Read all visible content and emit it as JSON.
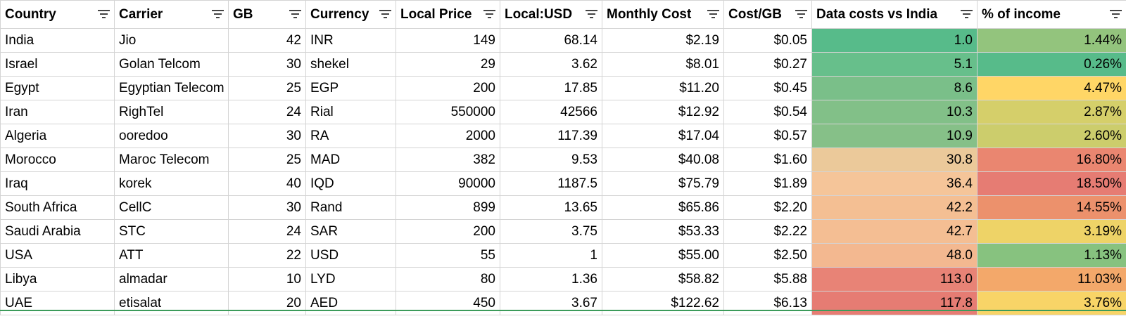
{
  "headers": [
    "Country",
    "Carrier",
    "GB",
    "Currency",
    "Local Price",
    "Local:USD",
    "Monthly Cost",
    "Cost/GB",
    "Data costs vs India",
    "% of income"
  ],
  "icons": {
    "filter": "filter-icon"
  },
  "colors": {
    "grid_line": "#d4d4d4",
    "frozen_bottom_line": "#3c9b5a"
  },
  "rows": [
    {
      "country": "India",
      "carrier": "Jio",
      "gb": "42",
      "currency": "INR",
      "local_price": "149",
      "local_usd": "68.14",
      "monthly_cost": "$2.19",
      "cost_gb": "$0.05",
      "vs_india": "1.0",
      "pct_income": "1.44%",
      "vs_color": "#57bb8a",
      "inc_color": "#93c47d"
    },
    {
      "country": "Israel",
      "carrier": "Golan Telcom",
      "gb": "30",
      "currency": "shekel",
      "local_price": "29",
      "local_usd": "3.62",
      "monthly_cost": "$8.01",
      "cost_gb": "$0.27",
      "vs_india": "5.1",
      "pct_income": "0.26%",
      "vs_color": "#67bf8b",
      "inc_color": "#57bb8a"
    },
    {
      "country": "Egypt",
      "carrier": "Egyptian Telecom",
      "gb": "25",
      "currency": "EGP",
      "local_price": "200",
      "local_usd": "17.85",
      "monthly_cost": "$11.20",
      "cost_gb": "$0.45",
      "vs_india": "8.6",
      "pct_income": "4.47%",
      "vs_color": "#7abf89",
      "inc_color": "#ffd666"
    },
    {
      "country": "Iran",
      "carrier": "RighTel",
      "gb": "24",
      "currency": "Rial",
      "local_price": "550000",
      "local_usd": "42566",
      "monthly_cost": "$12.92",
      "cost_gb": "$0.54",
      "vs_india": "10.3",
      "pct_income": "2.87%",
      "vs_color": "#82c088",
      "inc_color": "#d5cf6a"
    },
    {
      "country": "Algeria",
      "carrier": "ooredoo",
      "gb": "30",
      "currency": "RA",
      "local_price": "2000",
      "local_usd": "117.39",
      "monthly_cost": "$17.04",
      "cost_gb": "$0.57",
      "vs_india": "10.9",
      "pct_income": "2.60%",
      "vs_color": "#86c088",
      "inc_color": "#cccd6c"
    },
    {
      "country": "Morocco",
      "carrier": "Maroc Telecom",
      "gb": "25",
      "currency": "MAD",
      "local_price": "382",
      "local_usd": "9.53",
      "monthly_cost": "$40.08",
      "cost_gb": "$1.60",
      "vs_india": "30.8",
      "pct_income": "16.80%",
      "vs_color": "#ebc99a",
      "inc_color": "#ea8670"
    },
    {
      "country": "Iraq",
      "carrier": "korek",
      "gb": "40",
      "currency": "IQD",
      "local_price": "90000",
      "local_usd": "1187.5",
      "monthly_cost": "$75.79",
      "cost_gb": "$1.89",
      "vs_india": "36.4",
      "pct_income": "18.50%",
      "vs_color": "#f5c599",
      "inc_color": "#e67c73"
    },
    {
      "country": "South Africa",
      "carrier": "CellC",
      "gb": "30",
      "currency": "Rand",
      "local_price": "899",
      "local_usd": "13.65",
      "monthly_cost": "$65.86",
      "cost_gb": "$2.20",
      "vs_india": "42.2",
      "pct_income": "14.55%",
      "vs_color": "#f4bf93",
      "inc_color": "#ec916c"
    },
    {
      "country": "Saudi Arabia",
      "carrier": "STC",
      "gb": "24",
      "currency": "SAR",
      "local_price": "200",
      "local_usd": "3.75",
      "monthly_cost": "$53.33",
      "cost_gb": "$2.22",
      "vs_india": "42.7",
      "pct_income": "3.19%",
      "vs_color": "#f4be93",
      "inc_color": "#eed367"
    },
    {
      "country": "USA",
      "carrier": "ATT",
      "gb": "22",
      "currency": "USD",
      "local_price": "55",
      "local_usd": "1",
      "monthly_cost": "$55.00",
      "cost_gb": "$2.50",
      "vs_india": "48.0",
      "pct_income": "1.13%",
      "vs_color": "#f3b890",
      "inc_color": "#87c27f"
    },
    {
      "country": "Libya",
      "carrier": "almadar",
      "gb": "10",
      "currency": "LYD",
      "local_price": "80",
      "local_usd": "1.36",
      "monthly_cost": "$58.82",
      "cost_gb": "$5.88",
      "vs_india": "113.0",
      "pct_income": "11.03%",
      "vs_color": "#e88376",
      "inc_color": "#f3a86a"
    },
    {
      "country": "UAE",
      "carrier": "etisalat",
      "gb": "20",
      "currency": "AED",
      "local_price": "450",
      "local_usd": "3.67",
      "monthly_cost": "$122.62",
      "cost_gb": "$6.13",
      "vs_india": "117.8",
      "pct_income": "3.76%",
      "vs_color": "#e67c73",
      "inc_color": "#f8d467"
    }
  ]
}
